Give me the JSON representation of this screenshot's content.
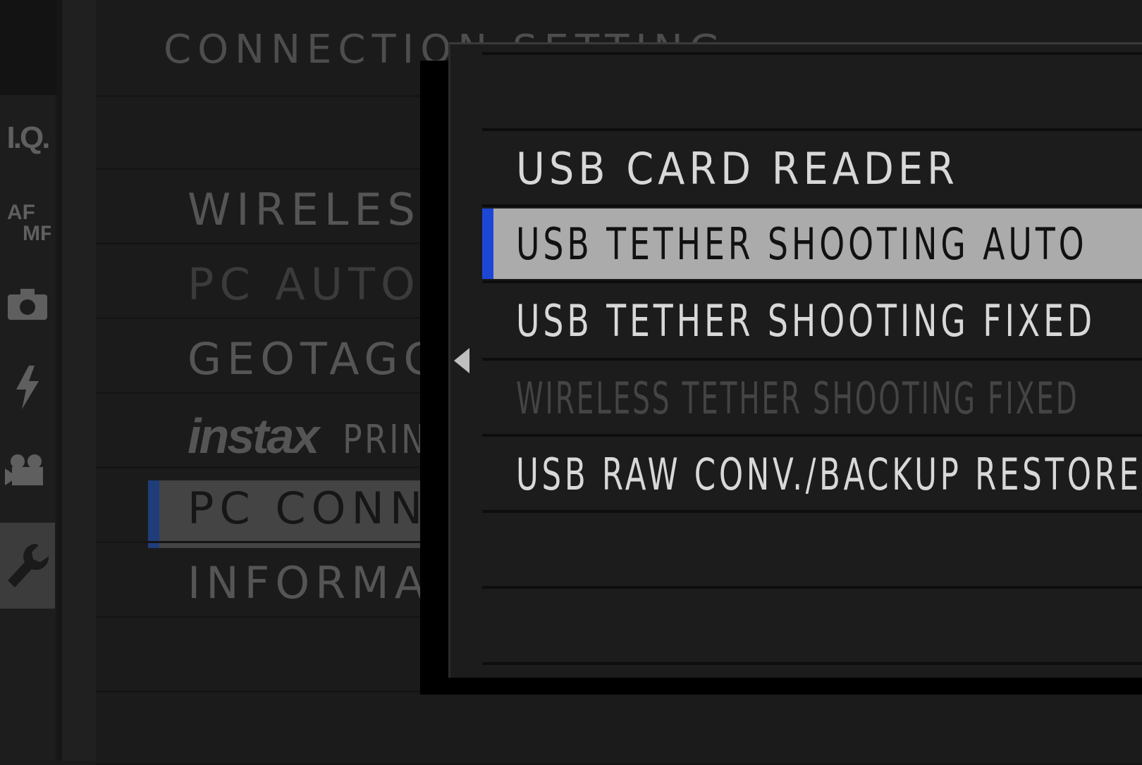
{
  "sidebar": {
    "tabs": [
      {
        "name": "iq-tab-icon",
        "label": "I.Q."
      },
      {
        "name": "af-mf-tab-icon",
        "label": "AF MF"
      },
      {
        "name": "camera-tab-icon",
        "label": ""
      },
      {
        "name": "flash-tab-icon",
        "label": ""
      },
      {
        "name": "movie-tab-icon",
        "label": ""
      },
      {
        "name": "wrench-tab-icon",
        "label": "",
        "active": true
      }
    ]
  },
  "background_menu": {
    "title": "CONNECTION SETTING",
    "items": [
      {
        "label": "WIRELESS",
        "dim": false
      },
      {
        "label": "PC AUTO S",
        "dim": true
      },
      {
        "label": "GEOTAGG",
        "dim": false
      },
      {
        "logo": "instax",
        "label": "PRINTER",
        "dim": false
      },
      {
        "label": "PC CONNE",
        "dim": false,
        "selected": true
      },
      {
        "label": "INFORMA",
        "dim": false
      }
    ]
  },
  "popup": {
    "options": [
      {
        "label": "USB CARD READER",
        "state": "normal"
      },
      {
        "label": "USB TETHER SHOOTING AUTO",
        "state": "selected"
      },
      {
        "label": "USB TETHER SHOOTING FIXED",
        "state": "normal"
      },
      {
        "label": "WIRELESS TETHER SHOOTING FIXED",
        "state": "disabled"
      },
      {
        "label": "USB RAW CONV./BACKUP RESTORE",
        "state": "normal"
      }
    ]
  },
  "colors": {
    "selection_accent": "#1c47d6",
    "selected_row": "#ababab",
    "background": "#1b1b1b"
  }
}
